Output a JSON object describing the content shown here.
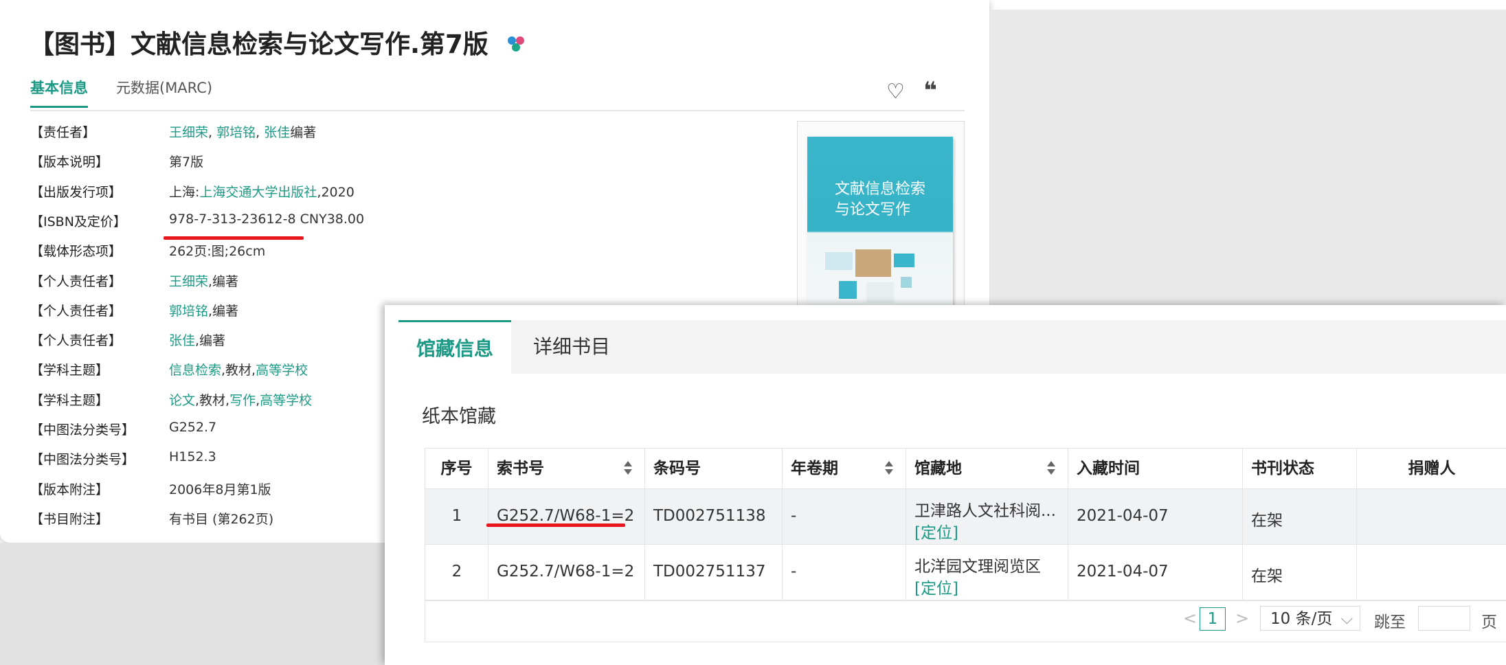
{
  "record": {
    "title": "【图书】文献信息检索与论文写作.第7版",
    "tabs": [
      "基本信息",
      "元数据(MARC)"
    ],
    "fields": [
      {
        "label": "【责任者】",
        "parts": [
          {
            "t": "王细荣",
            "link": true
          },
          {
            "t": ", ",
            "link": false
          },
          {
            "t": "郭培铭",
            "link": true
          },
          {
            "t": ", ",
            "link": false
          },
          {
            "t": "张佳",
            "link": true
          },
          {
            "t": "编著",
            "link": false
          }
        ]
      },
      {
        "label": "【版本说明】",
        "parts": [
          {
            "t": "第7版",
            "link": false
          }
        ]
      },
      {
        "label": "【出版发行项】",
        "parts": [
          {
            "t": "上海:",
            "link": false
          },
          {
            "t": "上海交通大学出版社",
            "link": true
          },
          {
            "t": ",2020",
            "link": false
          }
        ]
      },
      {
        "label": "【ISBN及定价】",
        "parts": [
          {
            "t": "978-7-313-23612-8 CNY38.00",
            "link": false
          }
        ]
      },
      {
        "label": "【载体形态项】",
        "parts": [
          {
            "t": "262页:图;26cm",
            "link": false
          }
        ]
      },
      {
        "label": "【个人责任者】",
        "parts": [
          {
            "t": "王细荣",
            "link": true
          },
          {
            "t": ",编著",
            "link": false
          }
        ]
      },
      {
        "label": "【个人责任者】",
        "parts": [
          {
            "t": "郭培铭",
            "link": true
          },
          {
            "t": ",编著",
            "link": false
          }
        ]
      },
      {
        "label": "【个人责任者】",
        "parts": [
          {
            "t": "张佳",
            "link": true
          },
          {
            "t": ",编著",
            "link": false
          }
        ]
      },
      {
        "label": "【学科主题】",
        "parts": [
          {
            "t": "信息检索",
            "link": true
          },
          {
            "t": ",教材,",
            "link": false
          },
          {
            "t": "高等学校",
            "link": true
          }
        ]
      },
      {
        "label": "【学科主题】",
        "parts": [
          {
            "t": "论文",
            "link": true
          },
          {
            "t": ",教材,",
            "link": false
          },
          {
            "t": "写作",
            "link": true
          },
          {
            "t": ",",
            "link": false
          },
          {
            "t": "高等学校",
            "link": true
          }
        ]
      },
      {
        "label": "【中图法分类号】",
        "parts": [
          {
            "t": "G252.7",
            "link": false
          }
        ]
      },
      {
        "label": "【中图法分类号】",
        "parts": [
          {
            "t": "H152.3",
            "link": false
          }
        ]
      },
      {
        "label": "【版本附注】",
        "parts": [
          {
            "t": "2006年8月第1版",
            "link": false
          }
        ]
      },
      {
        "label": "【书目附注】",
        "parts": [
          {
            "t": "有书目 (第262页)",
            "link": false
          }
        ]
      }
    ],
    "cover_text": [
      "文献信息检索",
      "与论文写作"
    ]
  },
  "holdings": {
    "tabs": [
      "馆藏信息",
      "详细书目"
    ],
    "section_title": "纸本馆藏",
    "columns": [
      "序号",
      "索书号",
      "条码号",
      "年卷期",
      "馆藏地",
      "入藏时间",
      "书刊状态",
      "捐赠人"
    ],
    "rows": [
      {
        "no": "1",
        "call": "G252.7/W68-1=2",
        "barcode": "TD002751138",
        "vol": "-",
        "loc": "卫津路人文社科阅...",
        "locate": "[定位]",
        "date": "2021-04-07",
        "status": "在架",
        "donor": ""
      },
      {
        "no": "2",
        "call": "G252.7/W68-1=2",
        "barcode": "TD002751137",
        "vol": "-",
        "loc": "北洋园文理阅览区",
        "locate": "[定位]",
        "date": "2021-04-07",
        "status": "在架",
        "donor": ""
      }
    ],
    "pager": {
      "prev": "<",
      "page": "1",
      "next": ">",
      "size": "10 条/页",
      "jump": "跳至",
      "page_suffix": "页"
    }
  },
  "colors": {
    "accent": "#1c9a86",
    "highlight": "#e8141b"
  }
}
